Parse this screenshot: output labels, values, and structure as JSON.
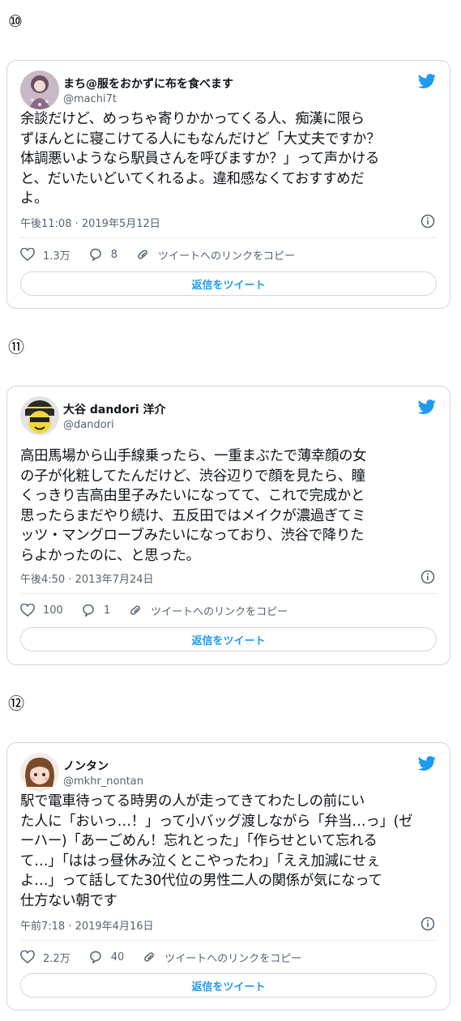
{
  "tweets": [
    {
      "index_label": "⑩",
      "name": "まち@服をおかずに布を食べます",
      "handle": "@machi7t",
      "text": "余談だけど、めっちゃ寄りかかってくる人、痴漢に限ら\nずほんとに寝こけてる人にもなんだけど「大丈夫ですか？\n体調悪いようなら駅員さんを呼びますか？」って声かける\nと、だいたいどいてくれるよ。違和感なくておすすめだ\nよ。",
      "timestamp": "午後11:08 · 2019年5月12日",
      "likes": "1.3万",
      "replies": "8",
      "copy_link": "ツイートへのリンクをコピー",
      "reply_button": "返信をツイート"
    },
    {
      "index_label": "⑪",
      "name": "大谷 dandori 洋介",
      "handle": "@dandori",
      "text": "高田馬場から山手線乗ったら、一重まぶたで薄幸顔の女\nの子が化粧してたんだけど、渋谷辺りで顔を見たら、瞳\nくっきり吉高由里子みたいになってて、これで完成かと\n思ったらまだやり続け、五反田ではメイクが濃過ぎてミ\nッツ・マングローブみたいになっており、渋谷で降りた\nらよかったのに、と思った。",
      "timestamp": "午後4:50 · 2013年7月24日",
      "likes": "100",
      "replies": "1",
      "copy_link": "ツイートへのリンクをコピー",
      "reply_button": "返信をツイート"
    },
    {
      "index_label": "⑫",
      "name": "ノンタン",
      "handle": "@mkhr_nontan",
      "text": "駅で電車待ってる時男の人が走ってきてわたしの前にい\nた人に「おいっ…！」って小バッグ渡しながら「弁当…っ」(ゼ\nーハー)「あーごめん！忘れとった」「作らせといて忘れる\nて…」「ははっ昼休み泣くとこやったわ」「ええ加減にせぇ\nよ…」って話してた30代位の男性二人の関係が気になって\n仕方ない朝です",
      "timestamp": "午前7:18 · 2019年4月16日",
      "likes": "2.2万",
      "replies": "40",
      "copy_link": "ツイートへのリンクをコピー",
      "reply_button": "返信をツイート"
    }
  ],
  "icons": {
    "bird": "twitter-bird-icon",
    "info": "info-icon",
    "like": "heart-icon",
    "reply": "reply-bubble-icon",
    "link": "link-icon"
  },
  "colors": {
    "accent": "#1d9bf0",
    "secondary_text": "#536471",
    "border": "#cfd9de"
  }
}
